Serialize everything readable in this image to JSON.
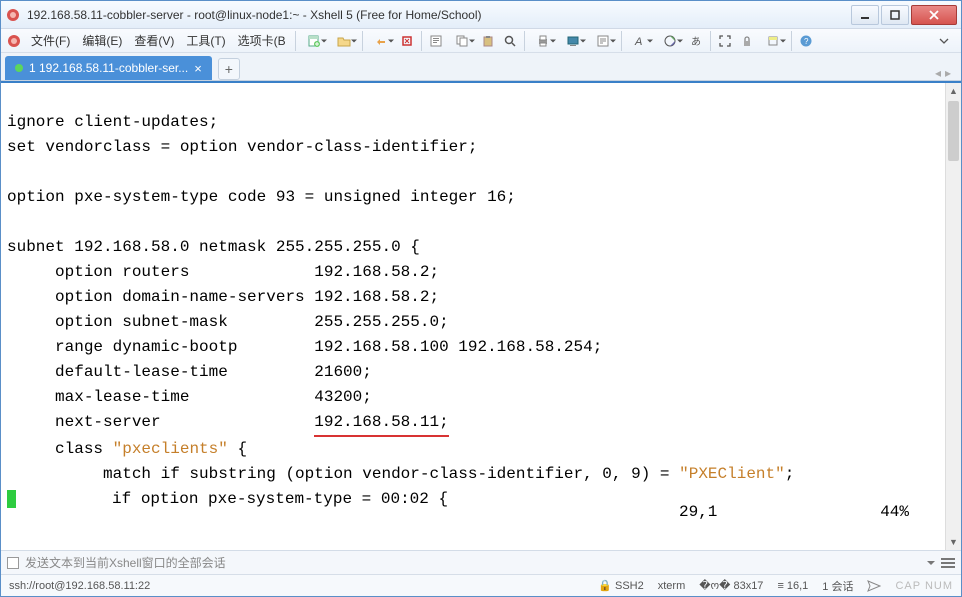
{
  "window": {
    "title": "192.168.58.11-cobbler-server - root@linux-node1:~ - Xshell 5 (Free for Home/School)"
  },
  "menu": {
    "file": "文件(F)",
    "edit": "编辑(E)",
    "view": "查看(V)",
    "tools": "工具(T)",
    "options": "选项卡(B"
  },
  "tab": {
    "label": "1 192.168.58.11-cobbler-ser...",
    "close": "×",
    "add": "+"
  },
  "terminal": {
    "l1": "ignore client-updates;",
    "l2": "set vendorclass = option vendor-class-identifier;",
    "l3": "",
    "l4": "option pxe-system-type code 93 = unsigned integer 16;",
    "l5": "",
    "l6": "subnet 192.168.58.0 netmask 255.255.255.0 {",
    "l7a": "     option routers             192.168.58.2;",
    "l8": "     option domain-name-servers 192.168.58.2;",
    "l9": "     option subnet-mask         255.255.255.0;",
    "l10": "     range dynamic-bootp        192.168.58.100 192.168.58.254;",
    "l11": "     default-lease-time         21600;",
    "l12": "     max-lease-time             43200;",
    "l13a": "     next-server                ",
    "l13b": "192.168.58.11;",
    "l14a": "     class ",
    "l14b": "\"pxeclients\"",
    "l14c": " {",
    "l15a": "          match if substring (option vendor-class-identifier, 0, 9) = ",
    "l15b": "\"PXEClient\"",
    "l15c": ";",
    "l16": "          if option pxe-system-type = 00:02 {",
    "status_pos": "29,1",
    "status_pct": "44%"
  },
  "compose": {
    "placeholder": "发送文本到当前Xshell窗口的全部会话"
  },
  "status": {
    "ssh_url": "ssh://root@192.168.58.11:22",
    "ssh2": "SSH2",
    "term": "xterm",
    "size": "83x17",
    "cursor": "16,1",
    "sessions": "1 会话",
    "watermark": "CAP  NUM  "
  }
}
